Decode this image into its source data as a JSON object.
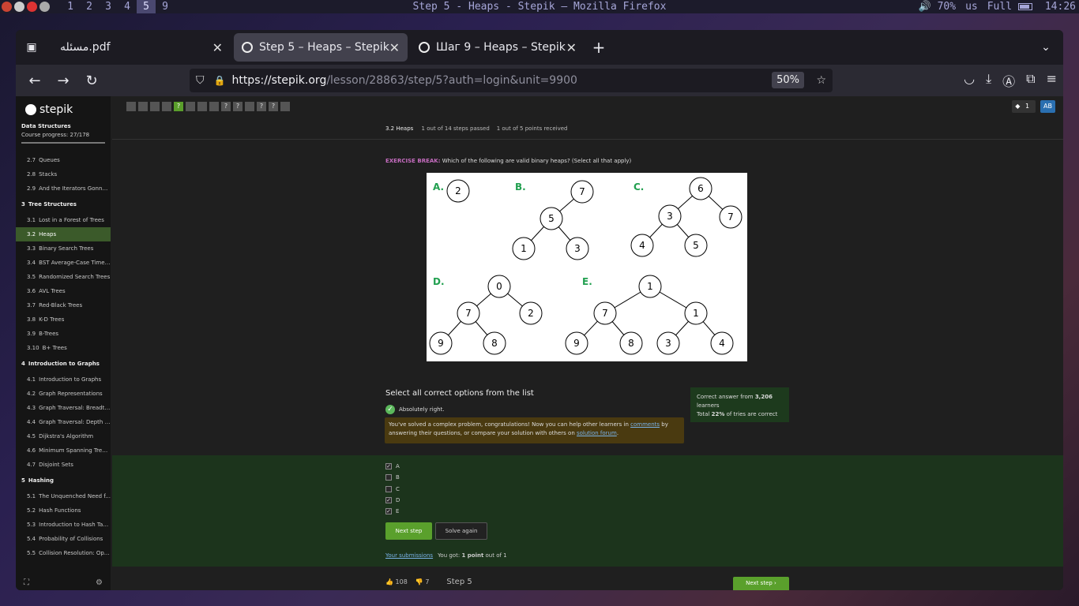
{
  "system_bar": {
    "workspaces": [
      "1",
      "2",
      "3",
      "4",
      "5",
      "9"
    ],
    "active_workspace": "5",
    "window_title": "Step 5 - Heaps - Stepik — Mozilla Firefox",
    "volume": "70%",
    "keyboard": "us",
    "battery": "Full",
    "time": "14:26"
  },
  "tabs": [
    {
      "label": "مسئله.pdf"
    },
    {
      "label": "Step 5 – Heaps – Stepik",
      "active": true
    },
    {
      "label": "Шаг 9 – Heaps – Stepik"
    }
  ],
  "navbar": {
    "url_base": "https://stepik.org",
    "url_path": "/lesson/28863/step/5?auth=login&unit=9900",
    "zoom": "50%"
  },
  "sidebar": {
    "logo": "stepik",
    "course_title": "Data Structures",
    "course_progress_label": "Course progress:",
    "course_progress_value": "27/178",
    "entries": [
      {
        "kind": "item",
        "num": "2.7",
        "label": "Queues"
      },
      {
        "kind": "item",
        "num": "2.8",
        "label": "Stacks"
      },
      {
        "kind": "item",
        "num": "2.9",
        "label": "And the Iterators Gonna ..."
      },
      {
        "kind": "section",
        "num": "3",
        "label": "Tree Structures"
      },
      {
        "kind": "item",
        "num": "3.1",
        "label": "Lost in a Forest of Trees"
      },
      {
        "kind": "item",
        "num": "3.2",
        "label": "Heaps",
        "active": true
      },
      {
        "kind": "item",
        "num": "3.3",
        "label": "Binary Search Trees"
      },
      {
        "kind": "item",
        "num": "3.4",
        "label": "BST Average-Case Time ..."
      },
      {
        "kind": "item",
        "num": "3.5",
        "label": "Randomized Search Trees"
      },
      {
        "kind": "item",
        "num": "3.6",
        "label": "AVL Trees"
      },
      {
        "kind": "item",
        "num": "3.7",
        "label": "Red-Black Trees"
      },
      {
        "kind": "item",
        "num": "3.8",
        "label": "K-D Trees"
      },
      {
        "kind": "item",
        "num": "3.9",
        "label": "B-Trees"
      },
      {
        "kind": "item",
        "num": "3.10",
        "label": "B+ Trees"
      },
      {
        "kind": "section",
        "num": "4",
        "label": "Introduction to Graphs"
      },
      {
        "kind": "item",
        "num": "4.1",
        "label": "Introduction to Graphs"
      },
      {
        "kind": "item",
        "num": "4.2",
        "label": "Graph Representations"
      },
      {
        "kind": "item",
        "num": "4.3",
        "label": "Graph Traversal: Breadth..."
      },
      {
        "kind": "item",
        "num": "4.4",
        "label": "Graph Traversal: Depth F..."
      },
      {
        "kind": "item",
        "num": "4.5",
        "label": "Dijkstra's Algorithm"
      },
      {
        "kind": "item",
        "num": "4.6",
        "label": "Minimum Spanning Tree..."
      },
      {
        "kind": "item",
        "num": "4.7",
        "label": "Disjoint Sets"
      },
      {
        "kind": "section",
        "num": "5",
        "label": "Hashing"
      },
      {
        "kind": "item",
        "num": "5.1",
        "label": "The Unquenched Need f..."
      },
      {
        "kind": "item",
        "num": "5.2",
        "label": "Hash Functions"
      },
      {
        "kind": "item",
        "num": "5.3",
        "label": "Introduction to Hash Tab..."
      },
      {
        "kind": "item",
        "num": "5.4",
        "label": "Probability of Collisions"
      },
      {
        "kind": "item",
        "num": "5.5",
        "label": "Collision Resolution: Op..."
      }
    ]
  },
  "step_squares": [
    "",
    "",
    "",
    "",
    "?",
    "",
    "",
    "",
    "?",
    "?",
    "",
    "?",
    "?",
    ""
  ],
  "header": {
    "lesson": "3.2 Heaps",
    "steps_passed": "1 out of 14 steps passed",
    "points": "1 out of 5 points  received",
    "badge_count": "1",
    "avatar": "AB"
  },
  "question": {
    "prefix": "EXERCISE BREAK:",
    "text": " Which of the following are valid binary heaps? (Select all that apply)"
  },
  "trees": {
    "labels": [
      "A.",
      "B.",
      "C.",
      "D.",
      "E."
    ],
    "A": [
      "2"
    ],
    "B": [
      "7",
      "5",
      "1",
      "3"
    ],
    "C": [
      "6",
      "3",
      "7",
      "4",
      "5"
    ],
    "D": [
      "0",
      "7",
      "2",
      "9",
      "8"
    ],
    "E": [
      "1",
      "7",
      "1",
      "9",
      "8",
      "3",
      "4"
    ]
  },
  "quiz": {
    "title": "Select all correct options from the list",
    "feedback": "Absolutely right.",
    "congrats_1": "You've solved a complex problem, congratulations! Now you can help other learners in ",
    "congrats_link_1": "comments",
    "congrats_2": " by answering their questions, or compare your solution with others on ",
    "congrats_link_2": "solution forum",
    "congrats_3": ".",
    "stats_line1_prefix": "Correct answer from ",
    "stats_learners": "3,206",
    "stats_line1_suffix": " learners",
    "stats_line2_prefix": "Total ",
    "stats_pct": "22%",
    "stats_line2_suffix": " of tries are correct",
    "options": [
      {
        "label": "A",
        "checked": true
      },
      {
        "label": "B",
        "checked": false
      },
      {
        "label": "C",
        "checked": false
      },
      {
        "label": "D",
        "checked": true
      },
      {
        "label": "E",
        "checked": true
      }
    ],
    "next_label": "Next step",
    "solve_again_label": "Solve again",
    "submissions_link": "Your submissions",
    "score_prefix": "You got: ",
    "score_bold": "1 point",
    "score_suffix": " out of 1"
  },
  "footer": {
    "likes": "108",
    "dislikes": "7",
    "step_label": "Step 5",
    "next_label": "Next step"
  }
}
